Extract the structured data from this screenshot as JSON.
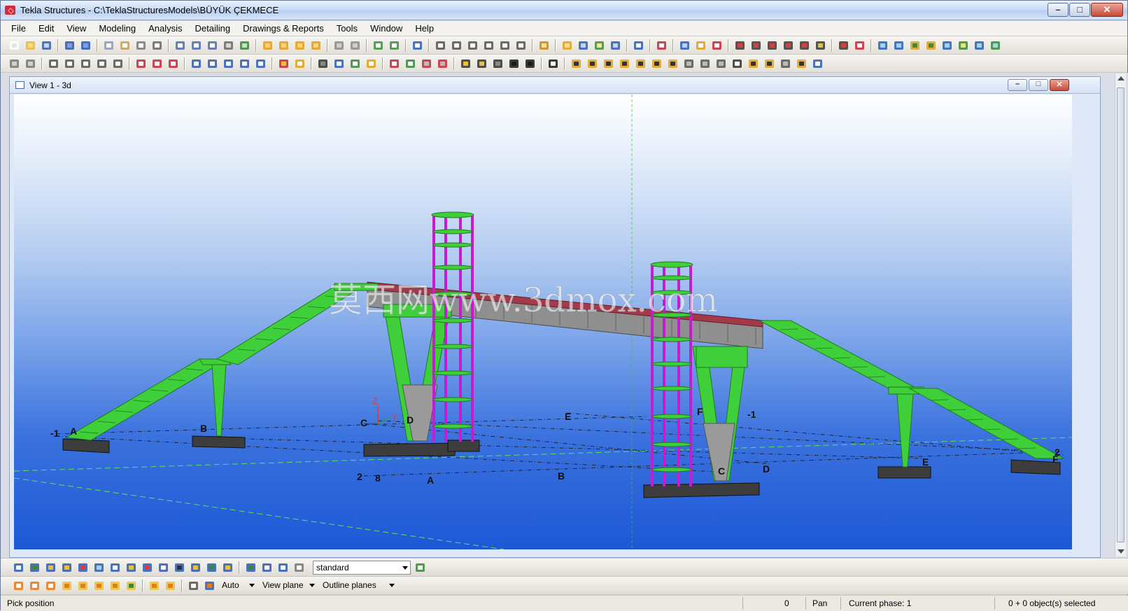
{
  "window": {
    "title": "Tekla Structures - C:\\TeklaStructuresModels\\BÜYÜK ÇEKMECE",
    "minimize": "–",
    "maximize": "□",
    "close": "✕"
  },
  "menu": [
    "File",
    "Edit",
    "View",
    "Modeling",
    "Analysis",
    "Detailing",
    "Drawings & Reports",
    "Tools",
    "Window",
    "Help"
  ],
  "view": {
    "title": "View 1 - 3d",
    "watermark": "莫西网www.3dmox.com",
    "grid_labels": {
      "left_1": "-1",
      "left_A": "A",
      "B_left": "B",
      "C_mid": "C",
      "D_mid": "D",
      "E_back": "E",
      "F_right": "F",
      "right_1": "-1",
      "row_2": "2",
      "row_8": "8",
      "A_front": "A",
      "B_front": "B",
      "C_front": "C",
      "D_front": "D",
      "E_right": "E",
      "right_2": "2",
      "right_F": "F",
      "axis_z": "Z",
      "axis_y": "Y"
    }
  },
  "bottom_toolbar": {
    "selection_filter": "standard",
    "snap_mode": "Auto",
    "plane": "View plane",
    "outline": "Outline planes"
  },
  "status": {
    "prompt": "Pick position",
    "count": "0",
    "mode": "Pan",
    "phase": "Current phase: 1",
    "selection": "0 + 0 object(s) selected"
  },
  "colors": {
    "structure_green": "#3fcf3a",
    "tower_magenta": "#c61bd1",
    "deck_red": "#a23a4a",
    "girder_gray": "#8c8c8c",
    "footing_dark": "#3f3f3f"
  }
}
